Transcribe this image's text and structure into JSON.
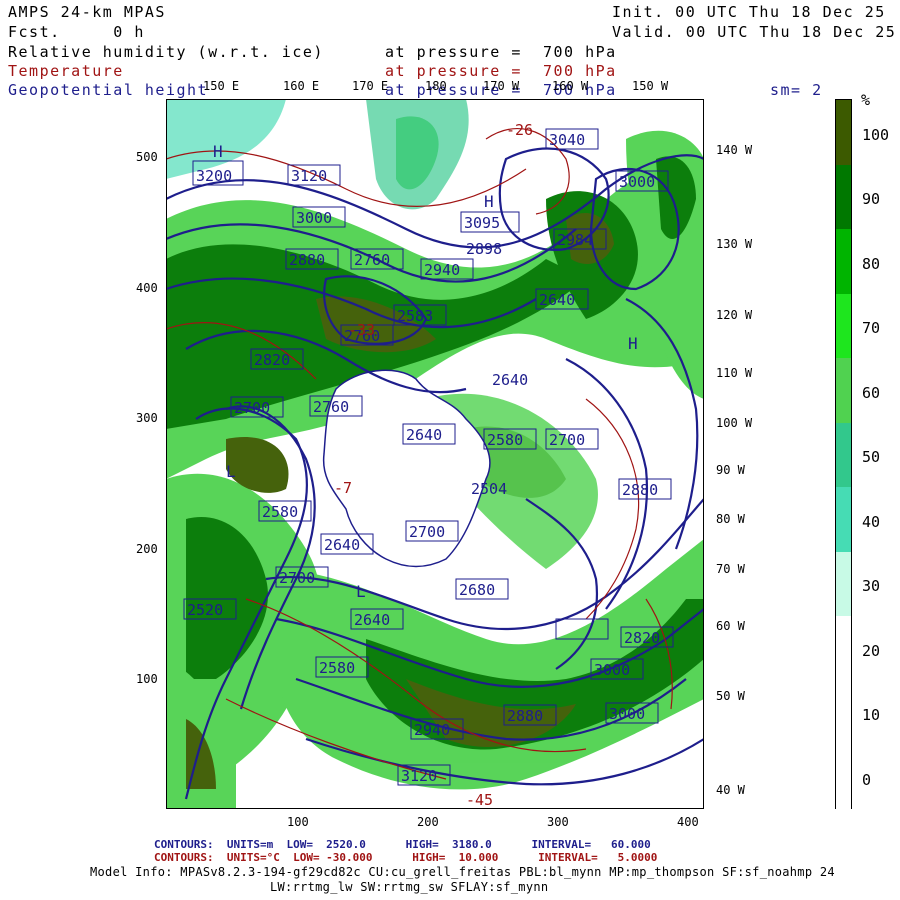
{
  "header": {
    "model": "AMPS 24-km MPAS",
    "fcst": "Fcst.     0 h",
    "init": "Init. 00 UTC Thu 18 Dec 25",
    "valid": "Valid. 00 UTC Thu 18 Dec 25",
    "fields": [
      {
        "name": "Relative humidity (w.r.t. ice)",
        "level": "at pressure =  700 hPa",
        "color": "#000000"
      },
      {
        "name": "Temperature",
        "level": "at pressure =  700 hPa",
        "color": "#a01414"
      },
      {
        "name": "Geopotential height",
        "level": "at pressure =  700 hPa",
        "color": "#1e1e8c"
      }
    ],
    "smoothing": "sm= 2"
  },
  "axes": {
    "top_lon": [
      "150 E",
      "160 E",
      "170 E",
      "180",
      "170 W",
      "160 W",
      "150 W"
    ],
    "right_lon": [
      "140 W",
      "130 W",
      "120 W",
      "110 W",
      "100 W",
      "90 W",
      "80 W",
      "70 W",
      "60 W",
      "50 W",
      "40 W"
    ],
    "left_y": [
      "500",
      "400",
      "300",
      "200",
      "100"
    ],
    "bottom_x": [
      "100",
      "200",
      "300",
      "400"
    ]
  },
  "colorbar": {
    "unit": "%",
    "labels": [
      "100",
      "90",
      "80",
      "70",
      "60",
      "50",
      "40",
      "30",
      "20",
      "10",
      "0"
    ],
    "colors": [
      "#3c5a00",
      "#007800",
      "#00b400",
      "#1ee61e",
      "#50d250",
      "#32c88c",
      "#46dcb4",
      "#c8fae6",
      "#ffffff",
      "#ffffff",
      "#ffffff"
    ]
  },
  "map": {
    "height_labels": [
      "3200",
      "3120",
      "3000",
      "2880",
      "2760",
      "2940",
      "3095",
      "2898",
      "3040",
      "3000",
      "2984",
      "2640",
      "2760",
      "2583",
      "2820",
      "2700",
      "2760",
      "2640",
      "2580",
      "2700",
      "2640",
      "2880",
      "2580",
      "2700",
      "2640",
      "2504",
      "2700",
      "2640",
      "2580",
      "2520",
      "2820",
      "2680",
      "3000",
      "2880",
      "3000",
      "2940",
      "3120"
    ],
    "pressure_centers": [
      "H",
      "H",
      "L",
      "L",
      "H"
    ],
    "temp_labels": [
      "-26",
      "-33",
      "-7",
      "-45"
    ]
  },
  "footer": {
    "line1_blue": "CONTOURS:  UNITS=m  LOW=  2520.0      HIGH=  3180.0      INTERVAL=   60.000",
    "line2_red": "CONTOURS:  UNITS=°C  LOW= -30.000      HIGH=  10.000      INTERVAL=   5.0000",
    "model_info": "Model Info: MPASv8.2.3-194-gf29cd82c CU:cu_grell_freitas PBL:bl_mynn MP:mp_thompson SF:sf_noahmp 24",
    "model_info2": "LW:rrtmg_lw SW:rrtmg_sw SFLAY:sf_mynn"
  }
}
